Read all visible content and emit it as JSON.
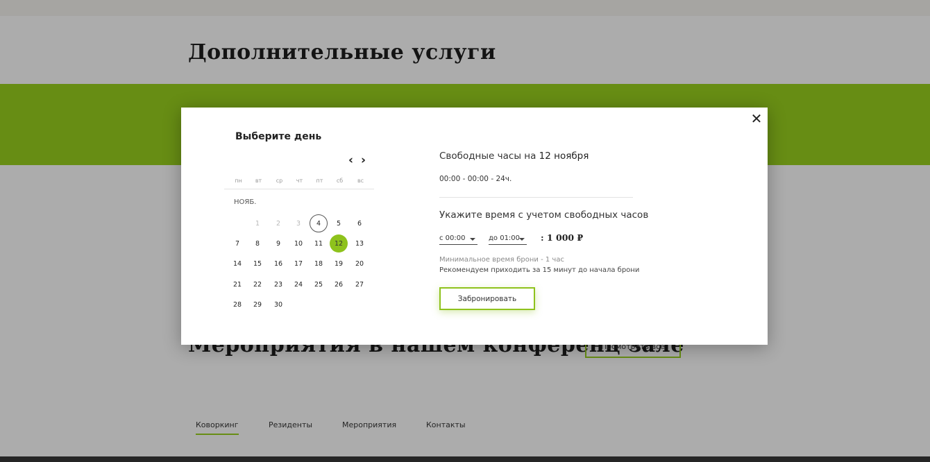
{
  "page": {
    "title": "Дополнительные услуги",
    "events_title": "Мероприятия в нашем конференц зале",
    "see_all_label": "Посмотреть все",
    "nav": [
      "Коворкинг",
      "Резиденты",
      "Мероприятия",
      "Контакты"
    ],
    "active_nav": "Коворкинг"
  },
  "modal": {
    "close_icon": "close-icon",
    "calendar": {
      "heading": "Выберите день",
      "prev_icon": "chevron-left-icon",
      "next_icon": "chevron-right-icon",
      "weekdays": [
        "пн",
        "вт",
        "ср",
        "чт",
        "пт",
        "сб",
        "вс"
      ],
      "month_label": "НОЯБ.",
      "days_past": [
        "1",
        "2",
        "3"
      ],
      "today": "4",
      "selected": "12",
      "weeks": [
        [
          "",
          "1",
          "2",
          "3",
          "4",
          "5",
          "6"
        ],
        [
          "7",
          "8",
          "9",
          "10",
          "11",
          "12",
          "13"
        ],
        [
          "14",
          "15",
          "16",
          "17",
          "18",
          "19",
          "20"
        ],
        [
          "21",
          "22",
          "23",
          "24",
          "25",
          "26",
          "27"
        ],
        [
          "28",
          "29",
          "30",
          "",
          "",
          "",
          ""
        ]
      ]
    },
    "booking": {
      "free_title_prefix": "Свободные часы на ",
      "free_title_date": "12 ноября",
      "free_hours": "00:00 - 00:00 - 24ч.",
      "specify_title": "Укажите время с учетом свободных часов",
      "from_value": "с 00:00",
      "to_value": "до 01:00",
      "price": ": 1 000 ₽",
      "note_min": "Минимальное время брони - 1 час",
      "note_recommend": "Рекомендуем приходить за 15 минут до начала брони",
      "book_label": "Забронировать"
    }
  },
  "colors": {
    "accent": "#8ec21c",
    "overlay": "rgba(0,0,0,0.27)",
    "footer": "#333333"
  }
}
